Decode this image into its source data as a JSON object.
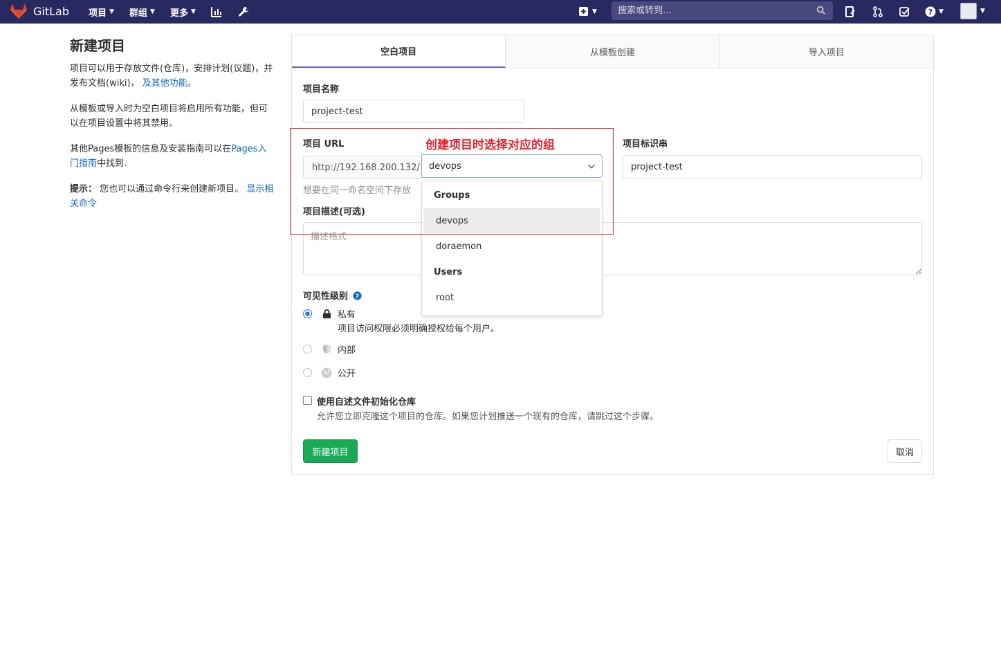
{
  "navbar": {
    "brand": "GitLab",
    "menus": [
      {
        "label": "项目"
      },
      {
        "label": "群组"
      },
      {
        "label": "更多"
      }
    ],
    "search_placeholder": "搜索或转到…",
    "icons": [
      "chart-icon",
      "wrench-icon",
      "plus-icon",
      "issues-icon",
      "merge-request-icon",
      "todo-icon",
      "help-icon",
      "avatar"
    ]
  },
  "sidebar": {
    "title": "新建项目",
    "para1": "项目可以用于存放文件(仓库)，安排计划(议题)，并发布文档(wiki)，",
    "para1_link": "及其他功能",
    "para1_end": "。",
    "para2": "从模板或导入时为空白项目将启用所有功能，但可以在项目设置中将其禁用。",
    "para3": "其他Pages模板的信息及安装指南可以在",
    "para3_link": "Pages入门指南",
    "para3_end": "中找到.",
    "tip_label": "提示：",
    "tip_text": "您也可以通过命令行来创建新项目。",
    "tip_link": "显示相关命令"
  },
  "tabs": [
    {
      "label": "空白项目",
      "active": true
    },
    {
      "label": "从模板创建",
      "active": false
    },
    {
      "label": "导入项目",
      "active": false
    }
  ],
  "form": {
    "name_label": "项目名称",
    "name_value": "project-test",
    "url_label": "项目 URL",
    "url_prefix": "http://192.168.200.132/",
    "namespace_value": "devops",
    "slug_label": "项目标识串",
    "slug_value": "project-test",
    "url_help": "想要在同一命名空间下存放",
    "desc_label": "项目描述(可选)",
    "desc_placeholder": "描述格式",
    "visibility_label": "可见性级别",
    "visibility": [
      {
        "label": "私有",
        "desc": "项目访问权限必须明确授权给每个用户。",
        "checked": true,
        "icon": "lock-icon"
      },
      {
        "label": "内部",
        "desc": "",
        "checked": false,
        "icon": "shield-icon"
      },
      {
        "label": "公开",
        "desc": "",
        "checked": false,
        "icon": "globe-icon"
      }
    ],
    "readme_label": "使用自述文件初始化仓库",
    "readme_desc": "允许您立即克隆这个项目的仓库。如果您计划推送一个现有的仓库，请跳过这个步骤。",
    "create_button": "新建项目",
    "cancel_button": "取消"
  },
  "dropdown": {
    "groups_header": "Groups",
    "groups": [
      "devops",
      "doraemon"
    ],
    "users_header": "Users",
    "users": [
      "root"
    ],
    "selected": "devops"
  },
  "annotation": {
    "text": "创建项目时选择对应的组",
    "color": "#e0242e"
  },
  "colors": {
    "navbar": "#292961",
    "primary_green": "#1aaa55",
    "link": "#1068bf",
    "tab_underline": "#6666c4"
  }
}
